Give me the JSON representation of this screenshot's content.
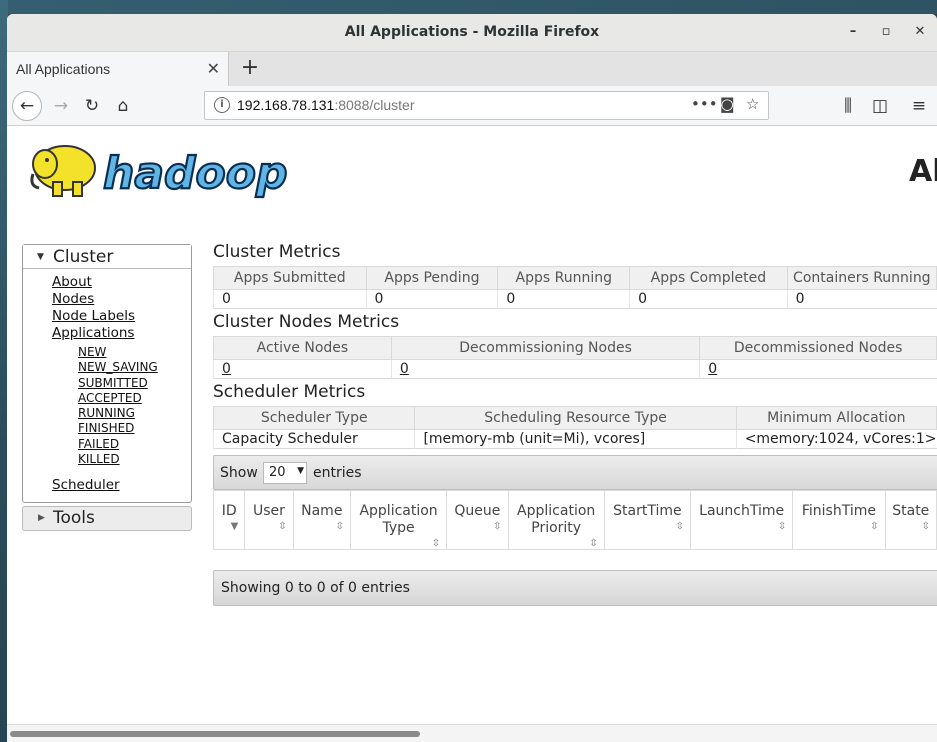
{
  "window": {
    "title": "All Applications - Mozilla Firefox"
  },
  "tab": {
    "label": "All Applications"
  },
  "url": {
    "host": "192.168.78.131",
    "rest": ":8088/cluster"
  },
  "page": {
    "heading": "All Applications",
    "logo_text": "hadoop"
  },
  "sidebar": {
    "cluster_label": "Cluster",
    "links": [
      "About",
      "Nodes",
      "Node Labels",
      "Applications"
    ],
    "states": [
      "NEW",
      "NEW_SAVING",
      "SUBMITTED",
      "ACCEPTED",
      "RUNNING",
      "FINISHED",
      "FAILED",
      "KILLED"
    ],
    "scheduler": "Scheduler",
    "tools_label": "Tools"
  },
  "cluster_metrics": {
    "title": "Cluster Metrics",
    "headers": [
      "Apps Submitted",
      "Apps Pending",
      "Apps Running",
      "Apps Completed",
      "Containers Running"
    ],
    "values": [
      "0",
      "0",
      "0",
      "0",
      "0"
    ]
  },
  "nodes_metrics": {
    "title": "Cluster Nodes Metrics",
    "headers": [
      "Active Nodes",
      "Decommissioning Nodes",
      "Decommissioned Nodes"
    ],
    "values": [
      "0",
      "0",
      "0"
    ]
  },
  "scheduler_metrics": {
    "title": "Scheduler Metrics",
    "headers": [
      "Scheduler Type",
      "Scheduling Resource Type",
      "Minimum Allocation"
    ],
    "values": [
      "Capacity Scheduler",
      "[memory-mb (unit=Mi), vcores]",
      "<memory:1024, vCores:1>"
    ]
  },
  "entries": {
    "show_label": "Show",
    "selected": "20",
    "entries_label": "entries"
  },
  "apps_table": {
    "columns": [
      {
        "label": "ID",
        "sort": "▼"
      },
      {
        "label": "User",
        "sort": "⇳"
      },
      {
        "label": "Name",
        "sort": "⇳"
      },
      {
        "label": "Application Type",
        "sort": "⇳"
      },
      {
        "label": "Queue",
        "sort": "⇳"
      },
      {
        "label": "Application Priority",
        "sort": "⇳"
      },
      {
        "label": "StartTime",
        "sort": "⇳"
      },
      {
        "label": "LaunchTime",
        "sort": "⇳"
      },
      {
        "label": "FinishTime",
        "sort": "⇳"
      },
      {
        "label": "State",
        "sort": "⇳"
      }
    ]
  },
  "footer": {
    "info": "Showing 0 to 0 of 0 entries"
  }
}
